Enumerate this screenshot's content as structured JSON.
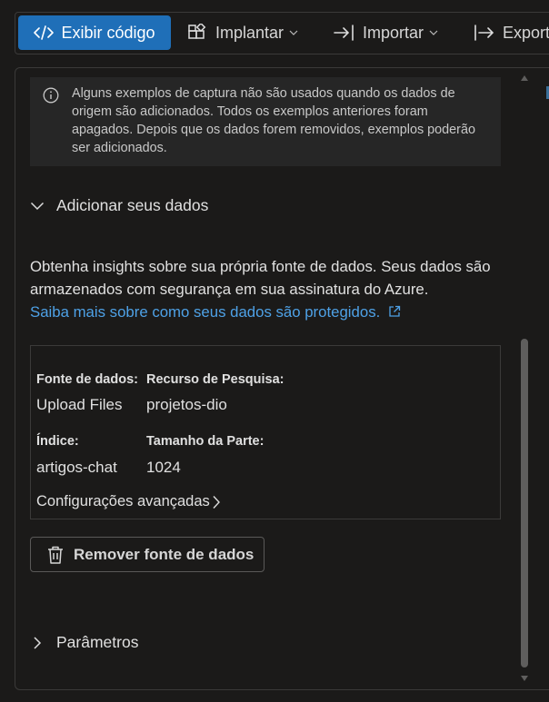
{
  "toolbar": {
    "view_code": "Exibir código",
    "deploy": "Implantar",
    "import": "Importar",
    "export": "Export"
  },
  "info_notice": {
    "text": "Alguns exemplos de captura não são usados quando os dados de origem são adicionados. Todos os exemplos anteriores foram apagados. Depois que os dados forem removidos, exemplos poderão ser adicionados.",
    "icon": "info-icon"
  },
  "add_data": {
    "title": "Adicionar seus dados",
    "description": "Obtenha insights sobre sua própria fonte de dados. Seus dados são armazenados com segurança em sua assinatura do Azure.",
    "learn_more": "Saiba mais sobre como seus dados são protegidos.",
    "card": {
      "data_source_label": "Fonte de dados:",
      "data_source_value": "Upload Files",
      "search_resource_label": "Recurso de Pesquisa:",
      "search_resource_value": "projetos-dio",
      "index_label": "Índice:",
      "index_value": "artigos-chat",
      "chunk_size_label": "Tamanho da Parte:",
      "chunk_size_value": "1024",
      "advanced_settings": "Configurações avançadas"
    },
    "remove_button": "Remover fonte de dados"
  },
  "parameters": {
    "title": "Parâmetros"
  },
  "colors": {
    "primary": "#1f6fb8",
    "link": "#4ea1e6",
    "background": "#1b1a19"
  }
}
